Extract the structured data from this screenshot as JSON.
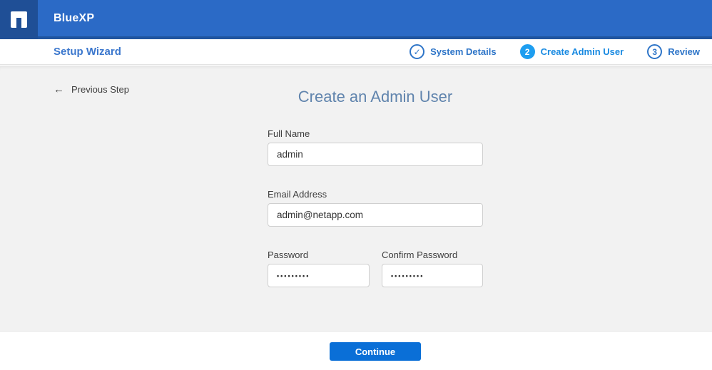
{
  "header": {
    "app_title": "BlueXP"
  },
  "wizard_bar": {
    "title": "Setup Wizard",
    "steps": [
      {
        "label": "System Details",
        "indicator": "✓",
        "status": "completed"
      },
      {
        "label": "Create Admin User",
        "indicator": "2",
        "status": "active"
      },
      {
        "label": "Review",
        "indicator": "3",
        "status": "upcoming"
      }
    ]
  },
  "main": {
    "back_arrow": "←",
    "previous_step_label": "Previous Step",
    "title": "Create an Admin User",
    "fields": {
      "full_name": {
        "label": "Full Name",
        "value": "admin"
      },
      "email": {
        "label": "Email Address",
        "value": "admin@netapp.com"
      },
      "password": {
        "label": "Password",
        "value": "•••••••••"
      },
      "confirm_password": {
        "label": "Confirm Password",
        "value": "•••••••••"
      }
    }
  },
  "footer": {
    "continue_label": "Continue"
  },
  "colors": {
    "topbar_blue": "#2b6ac6",
    "logo_navy": "#1f4f96",
    "wizard_title_blue": "#3b77cd",
    "step_blue": "#2e75c8",
    "active_step_circle": "#1e9ef0",
    "active_step_label": "#1789e1",
    "form_title_blue_gray": "#6084ad",
    "main_background": "#f2f2f2",
    "continue_button_blue": "#0a6fd7"
  }
}
